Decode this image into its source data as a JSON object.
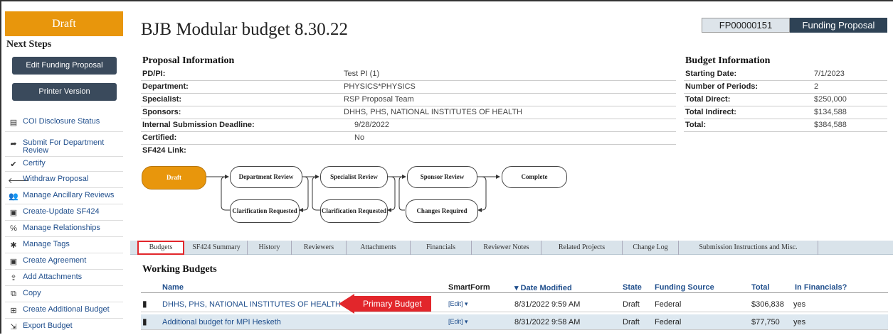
{
  "sidebar": {
    "state": "Draft",
    "next_steps_title": "Next Steps",
    "buttons": [
      "Edit Funding Proposal",
      "Printer Version"
    ],
    "items": [
      {
        "icon": "list-icon",
        "label": "COI Disclosure Status"
      },
      {
        "icon": "arrow-right-icon",
        "label": "Submit For Department Review"
      },
      {
        "icon": "check-icon",
        "label": "Certify"
      },
      {
        "icon": "arrow-left-icon",
        "label": "Withdraw Proposal"
      },
      {
        "icon": "users-icon",
        "label": "Manage Ancillary Reviews"
      },
      {
        "icon": "form-icon",
        "label": "Create-Update SF424"
      },
      {
        "icon": "link-icon",
        "label": "Manage Relationships"
      },
      {
        "icon": "gear-icon",
        "label": "Manage Tags"
      },
      {
        "icon": "form-icon",
        "label": "Create Agreement"
      },
      {
        "icon": "upload-icon",
        "label": "Add Attachments"
      },
      {
        "icon": "copy-icon",
        "label": "Copy"
      },
      {
        "icon": "add-icon",
        "label": "Create Additional Budget"
      },
      {
        "icon": "export-icon",
        "label": "Export Budget"
      }
    ]
  },
  "header": {
    "title": "BJB Modular budget 8.30.22",
    "id": "FP00000151",
    "type": "Funding Proposal"
  },
  "proposal_info": {
    "title": "Proposal Information",
    "rows": [
      {
        "key": "PD/PI:",
        "value": "Test PI (1)"
      },
      {
        "key": "Department:",
        "value": "PHYSICS*PHYSICS"
      },
      {
        "key": "Specialist:",
        "value": "RSP Proposal Team"
      },
      {
        "key": "Sponsors:",
        "value": "DHHS, PHS, NATIONAL INSTITUTES OF HEALTH"
      },
      {
        "key": "Internal Submission Deadline:",
        "value": "9/28/2022"
      },
      {
        "key": "Certified:",
        "value": "No"
      },
      {
        "key": "SF424 Link:",
        "value": ""
      }
    ]
  },
  "budget_info": {
    "title": "Budget Information",
    "rows": [
      {
        "key": "Starting Date:",
        "value": "7/1/2023"
      },
      {
        "key": "Number of Periods:",
        "value": "2"
      },
      {
        "key": "Total Direct:",
        "value": "$250,000"
      },
      {
        "key": "Total Indirect:",
        "value": "$134,588"
      },
      {
        "key": "Total:",
        "value": "$384,588"
      }
    ]
  },
  "workflow": {
    "draft": "Draft",
    "department_review": "Department Review",
    "specialist_review": "Specialist Review",
    "sponsor_review": "Sponsor Review",
    "complete": "Complete",
    "clarification_1": "Clarification Requested",
    "clarification_2": "Clarification Requested",
    "changes_required": "Changes Required"
  },
  "tabs": [
    "Budgets",
    "SF424 Summary",
    "History",
    "Reviewers",
    "Attachments",
    "Financials",
    "Reviewer Notes",
    "Related Projects",
    "Change Log",
    "Submission Instructions and Misc."
  ],
  "working_budgets": {
    "title": "Working Budgets",
    "columns": {
      "name": "Name",
      "smartform": "SmartForm",
      "date": "▾ Date Modified",
      "state": "State",
      "funding": "Funding Source",
      "total": "Total",
      "in_fin": "In Financials?"
    },
    "rows": [
      {
        "name": "DHHS, PHS, NATIONAL INSTITUTES OF HEALTH",
        "smartform": "[Edit] ▾",
        "date": "8/31/2022 9:59 AM",
        "state": "Draft",
        "funding": "Federal",
        "total": "$306,838",
        "in_fin": "yes"
      },
      {
        "name": "Additional budget for MPI Hesketh",
        "smartform": "[Edit] ▾",
        "date": "8/31/2022 9:58 AM",
        "state": "Draft",
        "funding": "Federal",
        "total": "$77,750",
        "in_fin": "yes"
      }
    ]
  },
  "callout": "Primary Budget",
  "colors": {
    "accent": "#e8960c",
    "nav_dark": "#2e4255",
    "callout": "#e2262b",
    "link": "#1f4e8c"
  }
}
